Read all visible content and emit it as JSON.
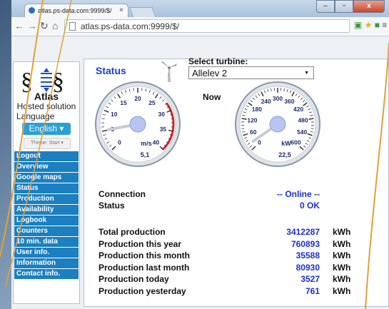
{
  "browser": {
    "tab_title": "atlas.ps-data.com:9999/$/",
    "tab_close": "×",
    "url": "atlas.ps-data.com:9999/$/",
    "window_min": "–",
    "window_max": "▫",
    "window_close": "x"
  },
  "sidebar": {
    "brand": "Atlas",
    "tagline": "Hosted solution",
    "language_label": "Language",
    "language_button": "English ▾",
    "theme_button": "Theme: Start ▾",
    "menu": [
      "Logout",
      "Overview",
      "Google maps",
      "Status",
      "Production",
      "Availability",
      "Logbook",
      "Counters",
      "10 min. data",
      "User info.",
      "Information",
      "Contact info."
    ]
  },
  "main": {
    "title": "Status",
    "select_label": "Select turbine:",
    "selected_turbine": "Allelev 2",
    "now_label": "Now",
    "wind_gauge": {
      "unit": "m/s",
      "value": "5,1",
      "ticks": [
        "0",
        "5",
        "10",
        "15",
        "20",
        "25",
        "30",
        "35",
        "40"
      ]
    },
    "power_gauge": {
      "unit": "kW",
      "value": "22,5",
      "ticks": [
        "0",
        "60",
        "120",
        "180",
        "240",
        "300",
        "360",
        "420",
        "480",
        "540",
        "600"
      ]
    },
    "connection": {
      "label": "Connection",
      "value": "-- Online --"
    },
    "status": {
      "label": "Status",
      "value": "0 OK"
    },
    "production": [
      {
        "label": "Total production",
        "value": "3412287",
        "unit": "kWh"
      },
      {
        "label": "Production this year",
        "value": "760893",
        "unit": "kWh"
      },
      {
        "label": "Production this month",
        "value": "35588",
        "unit": "kWh"
      },
      {
        "label": "Production last month",
        "value": "80930",
        "unit": "kWh"
      },
      {
        "label": "Production today",
        "value": "3527",
        "unit": "kWh"
      },
      {
        "label": "Production yesterday",
        "value": "761",
        "unit": "kWh"
      }
    ]
  },
  "colors": {
    "accent": "#1a3cd6",
    "menu": "#1b7fc0",
    "language_button": "#2a9fd6"
  }
}
